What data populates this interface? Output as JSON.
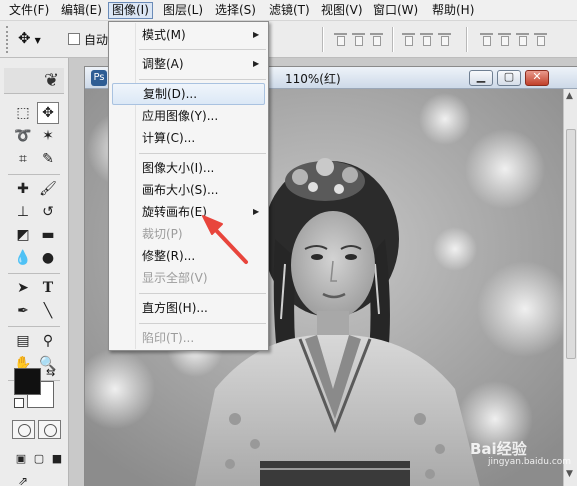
{
  "menubar": {
    "items": [
      "文件(F)",
      "编辑(E)",
      "图像(I)",
      "图层(L)",
      "选择(S)",
      "滤镜(T)",
      "视图(V)",
      "窗口(W)",
      "帮助(H)"
    ],
    "active": "图像(I)"
  },
  "options_bar": {
    "move_tool_icon": "move-arrow-icon",
    "auto_select_label": "自动",
    "align_icons": [
      "align-top-icon",
      "align-vcenter-icon",
      "align-bottom-icon",
      "align-left-icon",
      "align-hcenter-icon",
      "align-right-icon",
      "distribute-top-icon",
      "distribute-vcenter-icon",
      "distribute-bottom-icon"
    ]
  },
  "toolbox": {
    "tools": [
      "marquee-icon",
      "move-icon",
      "lasso-icon",
      "magic-wand-icon",
      "crop-icon",
      "slice-icon",
      "healing-brush-icon",
      "brush-icon",
      "clone-stamp-icon",
      "history-brush-icon",
      "eraser-icon",
      "gradient-icon",
      "blur-icon",
      "dodge-icon",
      "path-select-icon",
      "type-icon",
      "pen-icon",
      "line-icon",
      "notes-icon",
      "eyedropper-icon",
      "hand-icon",
      "zoom-icon"
    ],
    "foreground_color": "#111111",
    "background_color": "#ffffff"
  },
  "document": {
    "title": "110%(红)",
    "buttons": [
      "minimize",
      "maximize",
      "close"
    ]
  },
  "image_menu": {
    "items": [
      {
        "label": "模式(M)",
        "submenu": true,
        "disabled": false
      },
      {
        "label": "调整(A)",
        "submenu": true,
        "disabled": false
      },
      {
        "label": "复制(D)...",
        "submenu": false,
        "disabled": false,
        "highlighted": true
      },
      {
        "label": "应用图像(Y)...",
        "submenu": false,
        "disabled": false
      },
      {
        "label": "计算(C)...",
        "submenu": false,
        "disabled": false
      },
      {
        "label": "图像大小(I)...",
        "submenu": false,
        "disabled": false
      },
      {
        "label": "画布大小(S)...",
        "submenu": false,
        "disabled": false
      },
      {
        "label": "旋转画布(E)",
        "submenu": true,
        "disabled": false
      },
      {
        "label": "裁切(P)",
        "submenu": false,
        "disabled": true
      },
      {
        "label": "修整(R)...",
        "submenu": false,
        "disabled": false
      },
      {
        "label": "显示全部(V)",
        "submenu": false,
        "disabled": true
      },
      {
        "label": "直方图(H)...",
        "submenu": false,
        "disabled": false
      },
      {
        "label": "陷印(T)...",
        "submenu": false,
        "disabled": true
      }
    ]
  },
  "watermark": {
    "text": "Bai经验",
    "sub": "jingyan.baidu.com"
  },
  "colors": {
    "menu_highlight": "#dce8f6",
    "annotation_arrow": "#e8453c"
  }
}
